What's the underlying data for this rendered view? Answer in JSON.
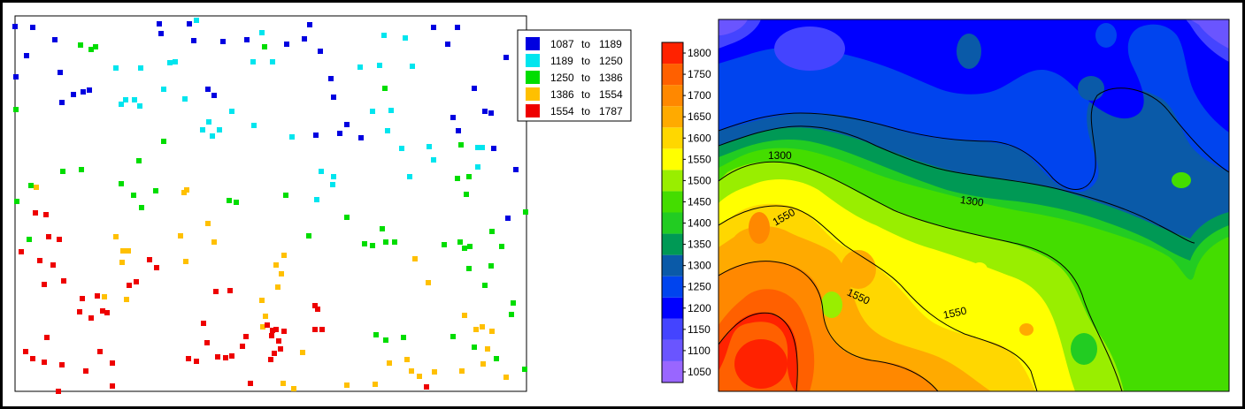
{
  "chart_data": [
    {
      "type": "scatter",
      "title": "",
      "xlabel": "",
      "ylabel": "",
      "legend_position": "top-right",
      "classes": [
        {
          "from": "1087",
          "sep": "to",
          "to": "1189",
          "color": "#0000e0"
        },
        {
          "from": "1189",
          "sep": "to",
          "to": "1250",
          "color": "#00e5ee"
        },
        {
          "from": "1250",
          "sep": "to",
          "to": "1386",
          "color": "#00dd00"
        },
        {
          "from": "1386",
          "sep": "to",
          "to": "1554",
          "color": "#ffc000"
        },
        {
          "from": "1554",
          "sep": "to",
          "to": "1787",
          "color": "#ee0000"
        }
      ],
      "points": [
        [
          17,
          30,
          0
        ],
        [
          37,
          31,
          0
        ],
        [
          30,
          63,
          0
        ],
        [
          62,
          45,
          0
        ],
        [
          18,
          87,
          0
        ],
        [
          68,
          82,
          0
        ],
        [
          94,
          104,
          0
        ],
        [
          83,
          107,
          0
        ],
        [
          101,
          102,
          0
        ],
        [
          70,
          116,
          0
        ],
        [
          180,
          27,
          0
        ],
        [
          182,
          38,
          0
        ],
        [
          214,
          27,
          0
        ],
        [
          219,
          46,
          0
        ],
        [
          252,
          47,
          0
        ],
        [
          279,
          45,
          0
        ],
        [
          324,
          50,
          0
        ],
        [
          350,
          28,
          0
        ],
        [
          344,
          44,
          0
        ],
        [
          362,
          58,
          0
        ],
        [
          374,
          89,
          0
        ],
        [
          377,
          110,
          0
        ],
        [
          235,
          101,
          0
        ],
        [
          242,
          108,
          0
        ],
        [
          490,
          31,
          0
        ],
        [
          517,
          31,
          0
        ],
        [
          506,
          50,
          0
        ],
        [
          536,
          100,
          0
        ],
        [
          548,
          126,
          0
        ],
        [
          555,
          128,
          0
        ],
        [
          572,
          65,
          0
        ],
        [
          357,
          153,
          0
        ],
        [
          384,
          151,
          0
        ],
        [
          392,
          141,
          0
        ],
        [
          408,
          156,
          0
        ],
        [
          518,
          148,
          0
        ],
        [
          558,
          168,
          0
        ],
        [
          583,
          192,
          0
        ],
        [
          574,
          247,
          0
        ],
        [
          512,
          133,
          0
        ],
        [
          222,
          23,
          1
        ],
        [
          296,
          37,
          1
        ],
        [
          131,
          77,
          1
        ],
        [
          159,
          77,
          1
        ],
        [
          192,
          71,
          1
        ],
        [
          198,
          70,
          1
        ],
        [
          185,
          101,
          1
        ],
        [
          142,
          113,
          1
        ],
        [
          158,
          120,
          1
        ],
        [
          152,
          113,
          1
        ],
        [
          137,
          118,
          1
        ],
        [
          209,
          112,
          1
        ],
        [
          236,
          138,
          1
        ],
        [
          229,
          147,
          1
        ],
        [
          240,
          154,
          1
        ],
        [
          248,
          147,
          1
        ],
        [
          262,
          126,
          1
        ],
        [
          286,
          70,
          1
        ],
        [
          308,
          70,
          1
        ],
        [
          287,
          142,
          1
        ],
        [
          330,
          155,
          1
        ],
        [
          434,
          40,
          1
        ],
        [
          458,
          43,
          1
        ],
        [
          429,
          74,
          1
        ],
        [
          407,
          76,
          1
        ],
        [
          466,
          75,
          1
        ],
        [
          442,
          125,
          1
        ],
        [
          421,
          126,
          1
        ],
        [
          438,
          148,
          1
        ],
        [
          490,
          181,
          1
        ],
        [
          485,
          166,
          1
        ],
        [
          540,
          167,
          1
        ],
        [
          540,
          189,
          1
        ],
        [
          545,
          167,
          1
        ],
        [
          363,
          194,
          1
        ],
        [
          377,
          200,
          1
        ],
        [
          376,
          209,
          1
        ],
        [
          358,
          226,
          1
        ],
        [
          463,
          200,
          1
        ],
        [
          454,
          168,
          1
        ],
        [
          103,
          56,
          2
        ],
        [
          108,
          53,
          2
        ],
        [
          91,
          51,
          2
        ],
        [
          299,
          53,
          2
        ],
        [
          435,
          100,
          2
        ],
        [
          521,
          164,
          2
        ],
        [
          157,
          182,
          2
        ],
        [
          185,
          160,
          2
        ],
        [
          92,
          192,
          2
        ],
        [
          71,
          194,
          2
        ],
        [
          18,
          124,
          2
        ],
        [
          19,
          228,
          2
        ],
        [
          151,
          221,
          2
        ],
        [
          137,
          208,
          2
        ],
        [
          160,
          235,
          2
        ],
        [
          176,
          216,
          2
        ],
        [
          259,
          227,
          2
        ],
        [
          267,
          229,
          2
        ],
        [
          323,
          221,
          2
        ],
        [
          392,
          246,
          2
        ],
        [
          349,
          267,
          2
        ],
        [
          412,
          276,
          2
        ],
        [
          421,
          278,
          2
        ],
        [
          432,
          259,
          2
        ],
        [
          436,
          274,
          2
        ],
        [
          446,
          274,
          2
        ],
        [
          502,
          277,
          2
        ],
        [
          520,
          274,
          2
        ],
        [
          525,
          281,
          2
        ],
        [
          531,
          279,
          2
        ],
        [
          527,
          220,
          2
        ],
        [
          517,
          202,
          2
        ],
        [
          556,
          262,
          2
        ],
        [
          567,
          279,
          2
        ],
        [
          594,
          240,
          2
        ],
        [
          593,
          418,
          2
        ],
        [
          425,
          379,
          2
        ],
        [
          436,
          385,
          2
        ],
        [
          456,
          382,
          2
        ],
        [
          512,
          381,
          2
        ],
        [
          33,
          271,
          2
        ],
        [
          35,
          210,
          2
        ],
        [
          530,
          200,
          2
        ],
        [
          555,
          301,
          2
        ],
        [
          530,
          304,
          2
        ],
        [
          548,
          323,
          2
        ],
        [
          580,
          343,
          2
        ],
        [
          578,
          356,
          2
        ],
        [
          536,
          393,
          2
        ],
        [
          561,
          406,
          2
        ],
        [
          41,
          212,
          3
        ],
        [
          208,
          218,
          3
        ],
        [
          211,
          215,
          3
        ],
        [
          131,
          268,
          3
        ],
        [
          204,
          267,
          3
        ],
        [
          242,
          274,
          3
        ],
        [
          235,
          253,
          3
        ],
        [
          138,
          297,
          3
        ],
        [
          139,
          284,
          3
        ],
        [
          145,
          284,
          3
        ],
        [
          210,
          296,
          3
        ],
        [
          321,
          289,
          3
        ],
        [
          312,
          300,
          3
        ],
        [
          318,
          310,
          3
        ],
        [
          314,
          325,
          3
        ],
        [
          296,
          340,
          3
        ],
        [
          300,
          358,
          3
        ],
        [
          297,
          370,
          3
        ],
        [
          342,
          399,
          3
        ],
        [
          320,
          434,
          3
        ],
        [
          332,
          440,
          3
        ],
        [
          392,
          436,
          3
        ],
        [
          424,
          435,
          3
        ],
        [
          440,
          411,
          3
        ],
        [
          465,
          420,
          3
        ],
        [
          460,
          407,
          3
        ],
        [
          474,
          426,
          3
        ],
        [
          491,
          421,
          3
        ],
        [
          469,
          293,
          3
        ],
        [
          484,
          320,
          3
        ],
        [
          545,
          370,
          3
        ],
        [
          525,
          357,
          3
        ],
        [
          538,
          373,
          3
        ],
        [
          556,
          375,
          3
        ],
        [
          551,
          395,
          3
        ],
        [
          546,
          412,
          3
        ],
        [
          522,
          420,
          3
        ],
        [
          572,
          427,
          3
        ],
        [
          143,
          339,
          3
        ],
        [
          118,
          336,
          3
        ],
        [
          40,
          241,
          4
        ],
        [
          52,
          243,
          4
        ],
        [
          55,
          268,
          4
        ],
        [
          67,
          271,
          4
        ],
        [
          24,
          285,
          4
        ],
        [
          45,
          295,
          4
        ],
        [
          60,
          300,
          4
        ],
        [
          72,
          318,
          4
        ],
        [
          50,
          322,
          4
        ],
        [
          93,
          338,
          4
        ],
        [
          110,
          335,
          4
        ],
        [
          116,
          352,
          4
        ],
        [
          121,
          354,
          4
        ],
        [
          103,
          360,
          4
        ],
        [
          169,
          294,
          4
        ],
        [
          177,
          303,
          4
        ],
        [
          154,
          319,
          4
        ],
        [
          146,
          323,
          4
        ],
        [
          53,
          382,
          4
        ],
        [
          29,
          398,
          4
        ],
        [
          37,
          406,
          4
        ],
        [
          50,
          410,
          4
        ],
        [
          70,
          413,
          4
        ],
        [
          97,
          420,
          4
        ],
        [
          113,
          398,
          4
        ],
        [
          127,
          411,
          4
        ],
        [
          127,
          437,
          4
        ],
        [
          66,
          443,
          4
        ],
        [
          213,
          406,
          4
        ],
        [
          222,
          409,
          4
        ],
        [
          230,
          366,
          4
        ],
        [
          234,
          388,
          4
        ],
        [
          246,
          404,
          4
        ],
        [
          255,
          405,
          4
        ],
        [
          262,
          403,
          4
        ],
        [
          278,
          381,
          4
        ],
        [
          274,
          392,
          4
        ],
        [
          244,
          330,
          4
        ],
        [
          260,
          329,
          4
        ],
        [
          302,
          368,
          4
        ],
        [
          308,
          374,
          4
        ],
        [
          312,
          373,
          4
        ],
        [
          321,
          375,
          4
        ],
        [
          315,
          386,
          4
        ],
        [
          317,
          395,
          4
        ],
        [
          310,
          400,
          4
        ],
        [
          306,
          407,
          4
        ],
        [
          283,
          434,
          4
        ],
        [
          356,
          346,
          4
        ],
        [
          359,
          350,
          4
        ],
        [
          356,
          373,
          4
        ],
        [
          364,
          373,
          4
        ],
        [
          307,
          380,
          4
        ],
        [
          482,
          438,
          4
        ],
        [
          90,
          353,
          4
        ]
      ],
      "xlim": [
        0,
        580
      ],
      "ylim": [
        0,
        420
      ],
      "grid": false
    },
    {
      "type": "heatmap",
      "title": "",
      "xlabel": "",
      "ylabel": "",
      "legend_position": "left",
      "colorbar": {
        "ticks": [
          "1050",
          "1100",
          "1150",
          "1200",
          "1250",
          "1300",
          "1350",
          "1400",
          "1450",
          "1500",
          "1550",
          "1600",
          "1650",
          "1700",
          "1750",
          "1800"
        ],
        "colors": [
          "#9966ff",
          "#6a55ff",
          "#4444ff",
          "#0000ff",
          "#0044ee",
          "#0a5aa8",
          "#009955",
          "#22cc22",
          "#44dd00",
          "#99ee00",
          "#ffff00",
          "#ffd700",
          "#ffaa00",
          "#ff8800",
          "#ff6000",
          "#ff2200"
        ]
      },
      "contour_labels": [
        "1300",
        "1550",
        "1300",
        "1550",
        "1550"
      ],
      "grid": false
    }
  ]
}
